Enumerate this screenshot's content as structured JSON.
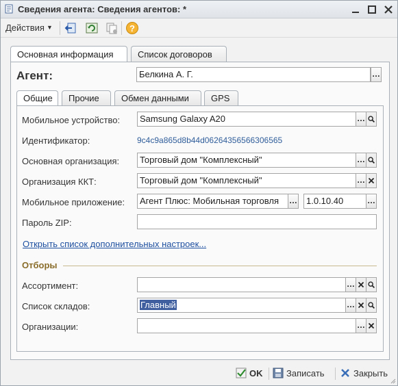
{
  "window": {
    "title": "Сведения агента: Сведения агентов:  *",
    "buttons": {
      "close": "✕",
      "maximize": "□",
      "minimize": "—"
    }
  },
  "toolbar": {
    "actions_label": "Действия",
    "icons": [
      "back-icon",
      "refresh-icon",
      "copy-icon",
      "help-icon"
    ]
  },
  "outer_tabs": [
    {
      "label": "Основная информация",
      "active": true
    },
    {
      "label": "Список договоров",
      "active": false
    }
  ],
  "agent": {
    "label": "Агент:",
    "value": "Белкина А. Г."
  },
  "inner_tabs": [
    {
      "label": "Общие",
      "active": true
    },
    {
      "label": "Прочие",
      "active": false
    },
    {
      "label": "Обмен данными",
      "active": false
    },
    {
      "label": "GPS",
      "active": false
    }
  ],
  "general": {
    "mobile_device": {
      "label": "Мобильное устройство:",
      "value": "Samsung Galaxy A20"
    },
    "identifier": {
      "label": "Идентификатор:",
      "value": "9c4c9a865d8b44d06264356566306565"
    },
    "main_org": {
      "label": "Основная организация:",
      "value": "Торговый дом \"Комплексный\""
    },
    "kkt_org": {
      "label": "Организация ККТ:",
      "value": "Торговый дом \"Комплексный\""
    },
    "mobile_app": {
      "label": "Мобильное приложение:",
      "value": "Агент Плюс: Мобильная торговля",
      "version": "1.0.10.40"
    },
    "zip_password": {
      "label": "Пароль ZIP:",
      "value": ""
    },
    "more_settings_link": "Открыть список дополнительных настроек..."
  },
  "filters": {
    "title": "Отборы",
    "assortment": {
      "label": "Ассортимент:",
      "value": ""
    },
    "warehouses": {
      "label": "Список складов:",
      "value": "Главный"
    },
    "organizations": {
      "label": "Организации:",
      "value": ""
    }
  },
  "footer": {
    "ok": "OK",
    "save": "Записать",
    "close": "Закрыть"
  },
  "colors": {
    "link": "#1d4fa0",
    "identifier": "#2f5d9a",
    "group_title": "#8a6d2a",
    "selection": "#3f5f9f"
  }
}
